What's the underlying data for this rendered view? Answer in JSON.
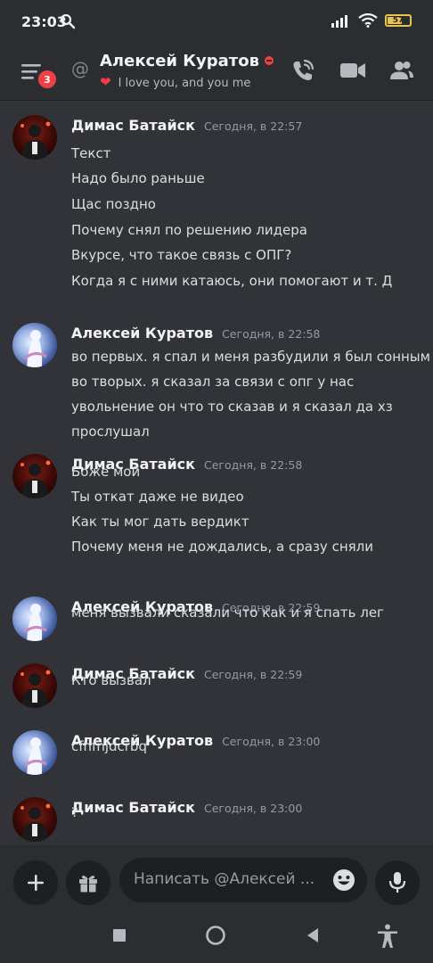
{
  "status_bar": {
    "time": "23:03",
    "battery": "57"
  },
  "header": {
    "unread_count": "3",
    "at_symbol": "@",
    "title": "Алексей Куратов",
    "custom_status": "I love you, and you  me",
    "status_emoji": "❤"
  },
  "icons": [
    "menu-icon",
    "at-icon",
    "dnd-status-icon",
    "heart-icon",
    "phone-call-icon",
    "video-camera-icon",
    "members-icon",
    "plus-icon",
    "gift-icon",
    "emoji-icon",
    "microphone-icon",
    "nav-square-icon",
    "nav-home-icon",
    "nav-back-icon",
    "accessibility-icon"
  ],
  "colors": {
    "background": "#313338",
    "panel": "#2b2d31",
    "input": "#1e1f22",
    "danger": "#f23f43"
  },
  "messages": [
    {
      "author": "Димас Батайск",
      "time": "Сегодня, в 22:57",
      "lines": [
        "Текст",
        "Надо было раньше",
        "Щас поздно",
        "Почему снял по решению лидера",
        "Вкурсе, что такое связь с ОПГ?",
        "Когда я с ними катаюсь, они помогают и т. Д"
      ]
    },
    {
      "author": "Алексей Куратов",
      "time": "Сегодня, в 22:58",
      "lines": [
        "во первых. я спал и меня разбудили я был сонным",
        "во творых. я сказал за связи с опг у нас",
        "увольнение он что то сказав и я сказал да хз",
        "прослушал"
      ]
    },
    {
      "author": "Димас Батайск",
      "time": "Сегодня, в 22:58",
      "lines": [
        "Боже мой",
        "Ты откат даже не видео",
        "Как ты мог дать вердикт",
        "Почему меня не дождались, а сразу сняли"
      ]
    },
    {
      "author": "Алексей Куратов",
      "time": "Сегодня, в 22:59",
      "lines": [
        "меня вызвали сказали что как и я спать лег"
      ]
    },
    {
      "author": "Димас Батайск",
      "time": "Сегодня, в 22:59",
      "lines": [
        "Кто вызвал"
      ]
    },
    {
      "author": "Алексей Куратов",
      "time": "Сегодня, в 23:00",
      "lines": [
        "cfhfnjdcrbq"
      ]
    },
    {
      "author": "Димас Батайск",
      "time": "Сегодня, в 23:00",
      "lines": [
        "?"
      ]
    }
  ],
  "composer": {
    "placeholder": "Написать @Алексей ..."
  }
}
